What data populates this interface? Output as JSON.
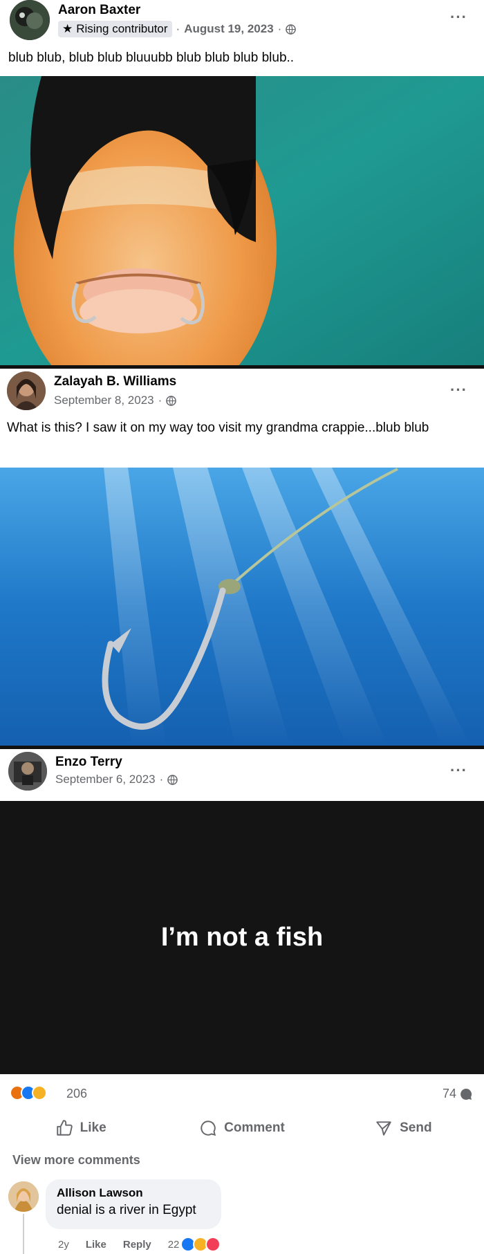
{
  "posts": [
    {
      "author": "Aaron Baxter",
      "badge": "Rising contributor",
      "date": "August 19, 2023",
      "separator": "·",
      "text": "blub blub, blub blub bluuubb blub blub blub blub.."
    },
    {
      "author": "Zalayah B. Williams",
      "date": "September 8, 2023",
      "separator": "·",
      "text": "What is this? I saw it on my way too visit my grandma crappie...blub blub"
    },
    {
      "author": "Enzo Terry",
      "date": "September 6, 2023",
      "separator": "·",
      "image_text": "I’m not a fish",
      "reaction_count": "206",
      "comment_count": "74",
      "actions": {
        "like": "Like",
        "comment": "Comment",
        "send": "Send"
      },
      "view_more": "View more comments",
      "comment": {
        "author": "Allison Lawson",
        "text": "denial is a river in Egypt",
        "age": "2y",
        "like": "Like",
        "reply": "Reply",
        "reaction_count": "22"
      }
    }
  ],
  "menu_glyph": "···",
  "colors": {
    "brand_blue": "#1877f2",
    "muted": "#65676b",
    "bubble": "#f0f2f5"
  }
}
